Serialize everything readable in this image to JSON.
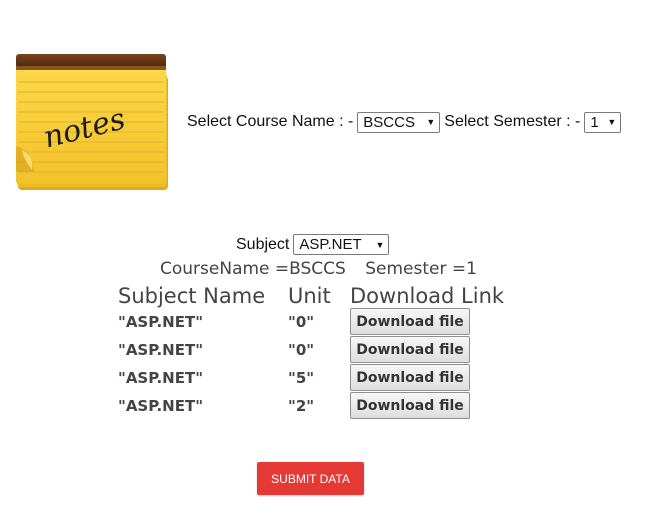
{
  "logo": {
    "text": "notes",
    "icon": "notepad-icon"
  },
  "filters": {
    "course_label": "Select Course Name : -",
    "course_value": "BSCCS",
    "semester_label": "Select Semester : -",
    "semester_value": "1"
  },
  "subject": {
    "label": "Subject",
    "value": "ASP.NET"
  },
  "info": {
    "course": "CourseName =BSCCS",
    "semester": "Semester =1"
  },
  "table": {
    "headers": [
      "Subject Name",
      "Unit",
      "Download Link"
    ],
    "rows": [
      {
        "subject": "\"ASP.NET\"",
        "unit": "\"0\"",
        "button": "Download file"
      },
      {
        "subject": "\"ASP.NET\"",
        "unit": "\"0\"",
        "button": "Download file"
      },
      {
        "subject": "\"ASP.NET\"",
        "unit": "\"5\"",
        "button": "Download file"
      },
      {
        "subject": "\"ASP.NET\"",
        "unit": "\"2\"",
        "button": "Download file"
      }
    ]
  },
  "submit_label": "SUBMIT DATA",
  "colors": {
    "submit_bg": "#e53935",
    "notepad_yellow": "#f7cf3a",
    "notepad_top": "#5a2f12"
  }
}
